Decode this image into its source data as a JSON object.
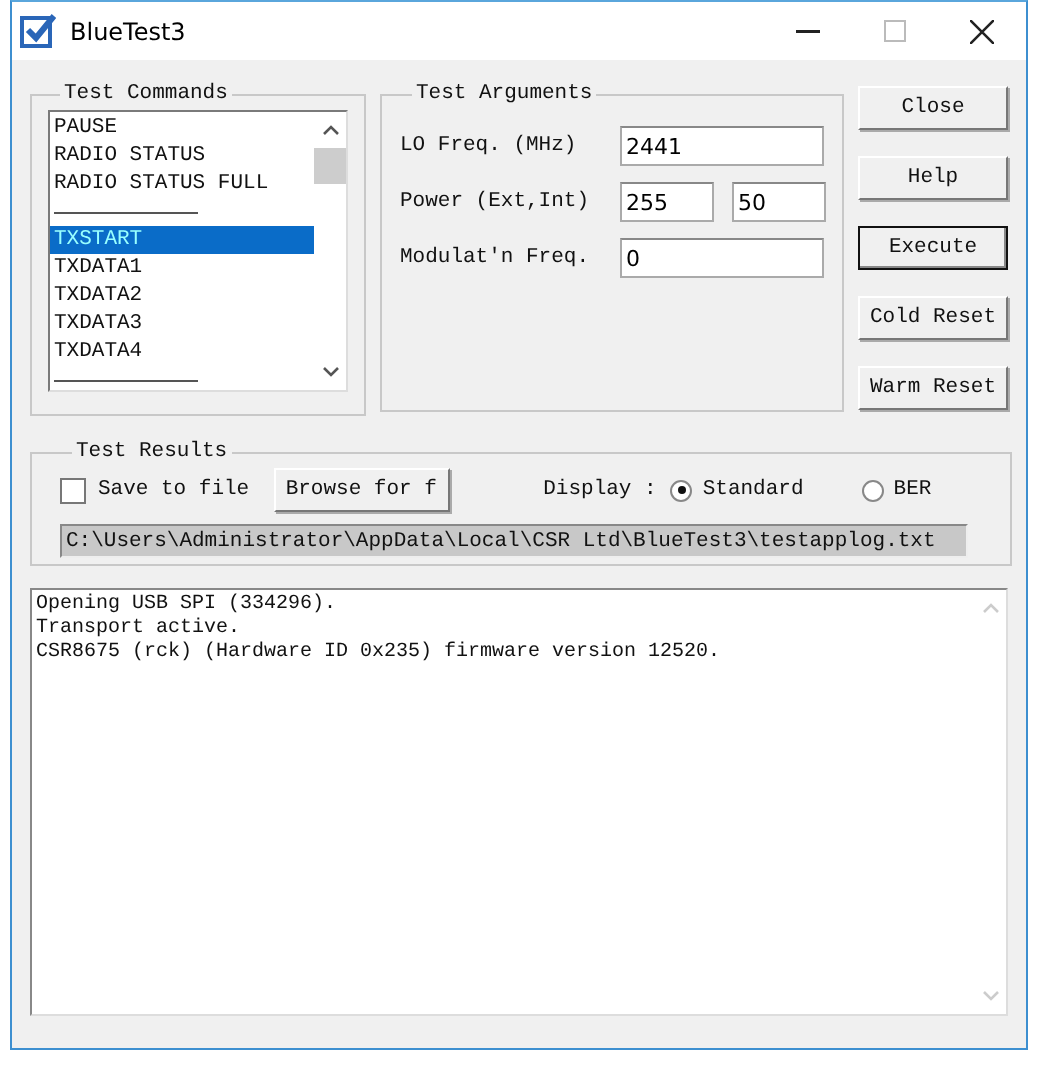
{
  "window": {
    "title": "BlueTest3"
  },
  "test_commands": {
    "label": "Test Commands",
    "items": [
      {
        "kind": "command",
        "label": "PAUSE",
        "selected": false
      },
      {
        "kind": "command",
        "label": "RADIO STATUS",
        "selected": false
      },
      {
        "kind": "command",
        "label": "RADIO STATUS FULL",
        "selected": false
      },
      {
        "kind": "separator"
      },
      {
        "kind": "command",
        "label": "TXSTART",
        "selected": true
      },
      {
        "kind": "command",
        "label": "TXDATA1",
        "selected": false
      },
      {
        "kind": "command",
        "label": "TXDATA2",
        "selected": false
      },
      {
        "kind": "command",
        "label": "TXDATA3",
        "selected": false
      },
      {
        "kind": "command",
        "label": "TXDATA4",
        "selected": false
      },
      {
        "kind": "separator"
      }
    ]
  },
  "test_arguments": {
    "label": "Test Arguments",
    "fields": [
      {
        "label": "LO Freq. (MHz)",
        "values": [
          "2441"
        ]
      },
      {
        "label": "Power (Ext,Int)",
        "values": [
          "255",
          "50"
        ]
      },
      {
        "label": "Modulat'n Freq.",
        "values": [
          "0"
        ]
      }
    ]
  },
  "buttons": [
    {
      "label": "Close",
      "default": false
    },
    {
      "label": "Help",
      "default": false
    },
    {
      "label": "Execute",
      "default": true
    },
    {
      "label": "Cold Reset",
      "default": false
    },
    {
      "label": "Warm Reset",
      "default": false
    }
  ],
  "test_results": {
    "label": "Test Results",
    "save_to_file": {
      "label": "Save to file",
      "checked": false
    },
    "browse_button": "Browse for f",
    "display": {
      "label": "Display :",
      "options": [
        {
          "label": "Standard",
          "selected": true
        },
        {
          "label": "BER",
          "selected": false
        }
      ]
    },
    "path": "C:\\Users\\Administrator\\AppData\\Local\\CSR Ltd\\BlueTest3\\testapplog.txt"
  },
  "log": {
    "lines": [
      "Opening USB SPI (334296).",
      "Transport active.",
      "CSR8675 (rck) (Hardware ID 0x235) firmware version 12520."
    ]
  }
}
